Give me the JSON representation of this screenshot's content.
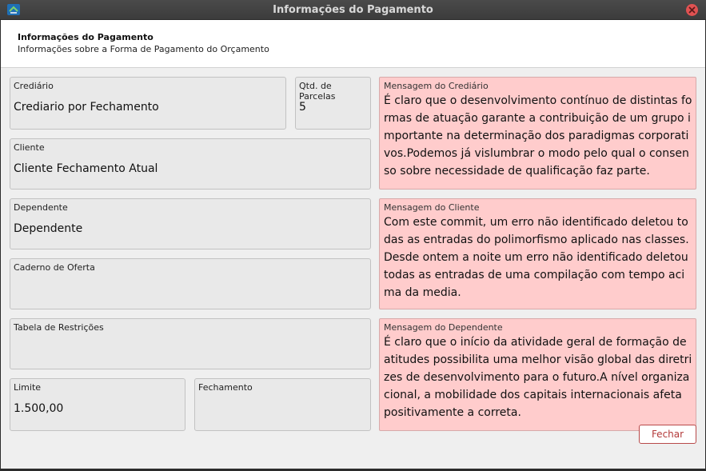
{
  "window": {
    "title": "Informações do Pagamento"
  },
  "header": {
    "title": "Informações do Pagamento",
    "subtitle": "Informações sobre a Forma de Pagamento do Orçamento"
  },
  "fields": {
    "crediario": {
      "label": "Crediário",
      "value": "Crediario por Fechamento"
    },
    "parcelas": {
      "label": "Qtd. de Parcelas",
      "value": "5"
    },
    "cliente": {
      "label": "Cliente",
      "value": "Cliente Fechamento Atual"
    },
    "dependente": {
      "label": "Dependente",
      "value": "Dependente"
    },
    "caderno": {
      "label": "Caderno de Oferta",
      "value": ""
    },
    "tabela": {
      "label": "Tabela de Restrições",
      "value": ""
    },
    "limite": {
      "label": "Limite",
      "value": "1.500,00"
    },
    "fechamento": {
      "label": "Fechamento",
      "value": ""
    }
  },
  "messages": {
    "crediario": {
      "label": "Mensagem do Crediário",
      "text": "É claro que o desenvolvimento contínuo de distintas formas de atuação garante a contribuição de um grupo importante na determinação dos paradigmas corporativos.Podemos já vislumbrar o modo pelo qual o consenso sobre necessidade de qualificação faz parte."
    },
    "cliente": {
      "label": "Mensagem do Cliente",
      "text": "Com este commit, um erro não identificado deletou todas as entradas do polimorfismo aplicado nas classes.Desde ontem a noite um erro não identificado deletou todas as entradas de uma compilação com tempo acima da media."
    },
    "dependente": {
      "label": "Mensagem do Dependente",
      "text": "É claro que o início da atividade geral de formação de atitudes possibilita uma melhor visão global das diretrizes de desenvolvimento para o futuro.A nível organizacional, a mobilidade dos capitais internacionais afeta positivamente a correta."
    }
  },
  "buttons": {
    "fechar": "Fechar"
  },
  "colors": {
    "message_bg": "#ffcccc",
    "close_circle": "#e05252",
    "button_accent": "#b33a3a"
  },
  "icons": {
    "app": "app-logo-icon",
    "close": "close-icon"
  }
}
